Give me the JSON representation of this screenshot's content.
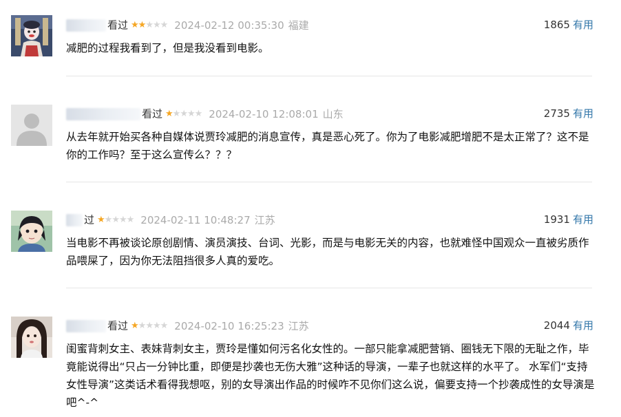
{
  "comments": [
    {
      "watched": "看过",
      "stars_on": "★★",
      "stars_off": "★★★",
      "time": "2024-02-12 00:35:30",
      "location": "福建",
      "votes": "1865",
      "useful": "有用",
      "text": "减肥的过程我看到了，但是我没看到电影。"
    },
    {
      "watched": "看过",
      "stars_on": "★",
      "stars_off": "★★★★",
      "time": "2024-02-10 12:08:01",
      "location": "山东",
      "votes": "2735",
      "useful": "有用",
      "text": "从去年就开始买各种自媒体说贾玲减肥的消息宣传，真是恶心死了。你为了电影减肥增肥不是太正常了？这不是你的工作吗？至于这么宣传么？？？"
    },
    {
      "watched": "过",
      "stars_on": "★",
      "stars_off": "★★★★",
      "time": "2024-02-11 10:48:27",
      "location": "江苏",
      "votes": "1931",
      "useful": "有用",
      "text": "当电影不再被谈论原创剧情、演员演技、台词、光影，而是与电影无关的内容，也就难怪中国观众一直被劣质作品喂屎了，因为你无法阻挡很多人真的爱吃。"
    },
    {
      "watched": "看过",
      "stars_on": "★",
      "stars_off": "★★★★",
      "time": "2024-02-10 16:25:23",
      "location": "江苏",
      "votes": "2044",
      "useful": "有用",
      "text": "闺蜜背刺女主、表妹背刺女主，贾玲是懂如何污名化女性的。一部只能拿减肥营销、圈钱无下限的无耻之作，毕竟能说得出“只占一分钟比重，即便是抄袭也无伤大雅”这种话的导演，一辈子也就这样的水平了。 水军们“支持女性导演”这类话术看得我想呕，别的女导演出作品的时候咋不见你们这么说，偏要支持一个抄袭成性的女导演是吧^-^"
    }
  ],
  "colors": {
    "star_on": "#f5a623",
    "star_off": "#d6d6d6",
    "link": "#3377aa",
    "meta_gray": "#aaaaaa"
  },
  "icons": {
    "avatar_1": "puppet-photo-avatar",
    "avatar_2": "default-user-avatar",
    "avatar_3": "anime-character-avatar",
    "avatar_4": "girl-photo-avatar"
  }
}
